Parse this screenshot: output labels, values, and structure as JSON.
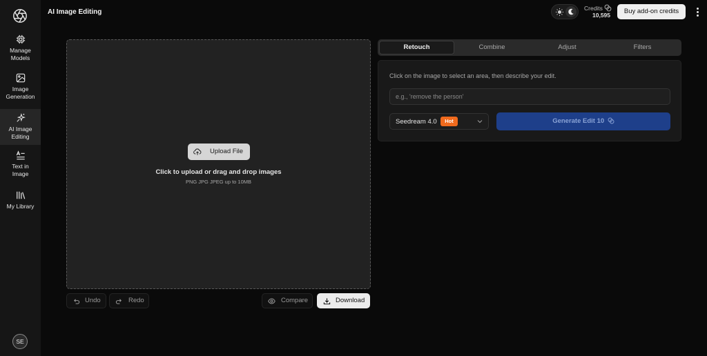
{
  "app": {
    "title": "AI Image Editing"
  },
  "sidebar": {
    "items": [
      {
        "label_line1": "Manage",
        "label_line2": "Models",
        "icon": "chip-icon"
      },
      {
        "label_line1": "Image",
        "label_line2": "Generation",
        "icon": "image-icon"
      },
      {
        "label_line1": "AI Image",
        "label_line2": "Editing",
        "icon": "sparkles-icon",
        "active": true
      },
      {
        "label_line1": "Text in",
        "label_line2": "Image",
        "icon": "text-icon"
      },
      {
        "label_line1": "My Library",
        "label_line2": "",
        "icon": "library-icon"
      }
    ],
    "avatar": "SE"
  },
  "header": {
    "credits_label": "Credits",
    "credits_value": "10,595",
    "buy_label": "Buy add-on credits"
  },
  "upload": {
    "button_label": "Upload File",
    "title": "Click to upload or drag and drop images",
    "subtitle": "PNG JPG JPEG up to 10MB"
  },
  "toolbar": {
    "undo_label": "Undo",
    "redo_label": "Redo",
    "compare_label": "Compare",
    "download_label": "Download"
  },
  "tabs": [
    {
      "label": "Retouch",
      "active": true
    },
    {
      "label": "Combine"
    },
    {
      "label": "Adjust"
    },
    {
      "label": "Filters"
    }
  ],
  "panel": {
    "hint": "Click on the image to select an area, then describe your edit.",
    "placeholder": "e.g., 'remove the person'",
    "value": "",
    "model": "Seedream 4.0",
    "model_badge": "Hot",
    "generate_label": "Generate Edit 10"
  },
  "colors": {
    "accent": "#1e3f8a",
    "badge": "#f06a1d",
    "background": "#0a0a0a"
  }
}
